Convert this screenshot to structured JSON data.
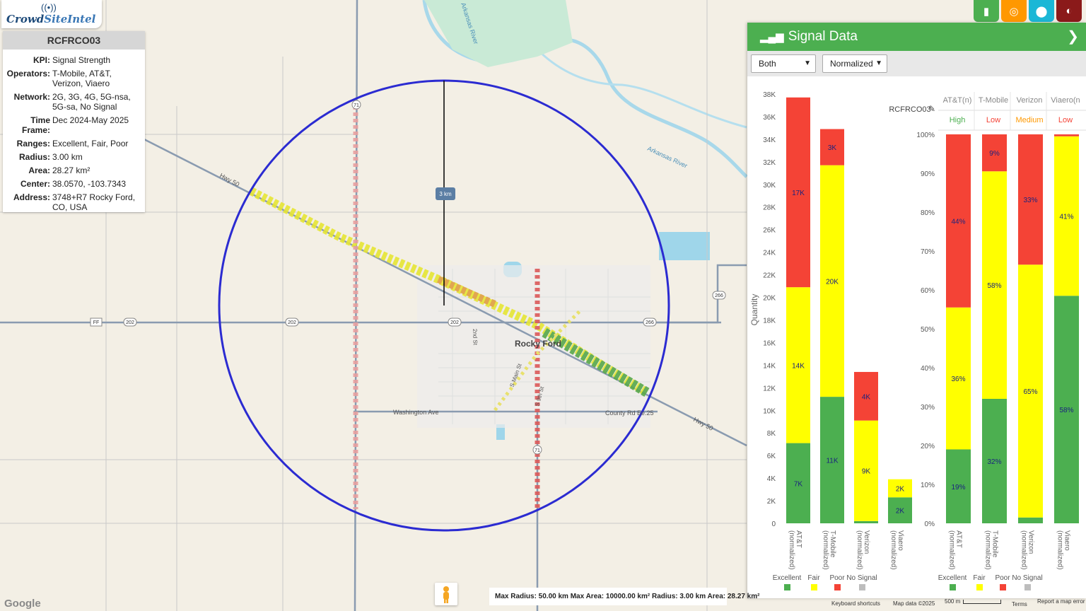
{
  "logo": {
    "text_a": "Crowd",
    "text_b": "SiteIntel"
  },
  "info": {
    "title": "RCFRCO03",
    "rows": [
      {
        "k": "KPI:",
        "v": "Signal Strength"
      },
      {
        "k": "Operators:",
        "v": "T-Mobile, AT&T, Verizon, Viaero"
      },
      {
        "k": "Network:",
        "v": "2G, 3G, 4G, 5G-nsa, 5G-sa, No Signal"
      },
      {
        "k": "Time Frame:",
        "v": "Dec 2024-May 2025"
      },
      {
        "k": "Ranges:",
        "v": "Excellent, Fair, Poor"
      },
      {
        "k": "Radius:",
        "v": "3.00 km"
      },
      {
        "k": "Area:",
        "v": "28.27 km²"
      },
      {
        "k": "Center:",
        "v": "38.0570, -103.7343"
      },
      {
        "k": "Address:",
        "v": "3748+R7 Rocky Ford, CO, USA"
      }
    ]
  },
  "topbar": {
    "buttons": [
      {
        "name": "bar-chart-icon",
        "color": "#4caf50",
        "glyph": "▮"
      },
      {
        "name": "target-icon",
        "color": "#ff9800",
        "glyph": "◎"
      },
      {
        "name": "pin-icon",
        "color": "#1bb7d6",
        "glyph": "⬤"
      },
      {
        "name": "globe-icon",
        "color": "#8b1a1a",
        "glyph": "◐"
      }
    ]
  },
  "panel": {
    "title": "Signal Data",
    "select_mode": "Both",
    "select_norm": "Normalized",
    "chart_title": "RCFRCO03",
    "rating_headers": [
      "AT&T(n)",
      "T-Mobile",
      "Verizon",
      "Viaero(n"
    ],
    "ratings": [
      "High",
      "Low",
      "Medium",
      "Low"
    ],
    "rating_colors": [
      "#4caf50",
      "#f44336",
      "#ff9800",
      "#f44336"
    ],
    "legend": [
      {
        "label": "Excellent",
        "color": "#4caf50"
      },
      {
        "label": "Fair",
        "color": "#ffff00"
      },
      {
        "label": "Poor",
        "color": "#f44336"
      },
      {
        "label": "No Signal",
        "color": "#bdbdbd"
      }
    ]
  },
  "chart_data": [
    {
      "type": "bar",
      "stacked": true,
      "title": "RCFRCO03",
      "ylabel": "Quantity",
      "ylim": [
        0,
        38000
      ],
      "yticks": [
        "0",
        "2K",
        "4K",
        "6K",
        "8K",
        "10K",
        "12K",
        "14K",
        "16K",
        "18K",
        "20K",
        "22K",
        "24K",
        "26K",
        "28K",
        "30K",
        "32K",
        "34K",
        "36K",
        "38K"
      ],
      "categories": [
        "AT&T (normalized)",
        "T-Mobile (normalized)",
        "Verizon (normalized)",
        "Viaero (normalized)"
      ],
      "series": [
        {
          "name": "Excellent",
          "color": "#4caf50",
          "values": [
            7100,
            11200,
            200,
            2300
          ],
          "labels": [
            "7K",
            "11K",
            "",
            "2K"
          ]
        },
        {
          "name": "Fair",
          "color": "#ffff00",
          "values": [
            13800,
            20500,
            8900,
            1600
          ],
          "labels": [
            "14K",
            "20K",
            "9K",
            "2K"
          ]
        },
        {
          "name": "Poor",
          "color": "#f44336",
          "values": [
            16800,
            3200,
            4300,
            0
          ],
          "labels": [
            "17K",
            "3K",
            "4K",
            ""
          ]
        }
      ]
    },
    {
      "type": "bar",
      "stacked": true,
      "ylim": [
        0,
        100
      ],
      "yticks": [
        "0%",
        "10%",
        "20%",
        "30%",
        "40%",
        "50%",
        "60%",
        "70%",
        "80%",
        "90%",
        "100%"
      ],
      "categories": [
        "AT&T (normalized)",
        "T-Mobile (normalized)",
        "Verizon (normalized)",
        "Viaero (normalized)"
      ],
      "series": [
        {
          "name": "Excellent",
          "color": "#4caf50",
          "values": [
            19,
            32,
            1.5,
            58.5
          ],
          "labels": [
            "19%",
            "32%",
            "",
            "58%"
          ]
        },
        {
          "name": "Fair",
          "color": "#ffff00",
          "values": [
            36.5,
            58.5,
            65,
            41
          ],
          "labels": [
            "36%",
            "58%",
            "65%",
            "41%"
          ]
        },
        {
          "name": "Poor",
          "color": "#f44336",
          "values": [
            44.5,
            9.5,
            33.5,
            0.5
          ],
          "labels": [
            "44%",
            "9%",
            "33%",
            ""
          ]
        }
      ]
    }
  ],
  "map": {
    "labels": {
      "town": "Rocky Ford",
      "river1": "Arkansas River",
      "river2": "Arkansas River",
      "hwy50w": "Hwy 50",
      "hwy50e": "Hwy 50",
      "washington": "Washington Ave",
      "county": "County Rd Ee.25",
      "second": "2nd St",
      "smain": "S Main St",
      "s9th": "S 9th St",
      "radius_tag": "3 km"
    },
    "shields": [
      "202",
      "202",
      "202",
      "266",
      "266",
      "FF",
      "71",
      "71"
    ]
  },
  "scale": {
    "text": "Max Radius: 50.00 km Max Area: 10000.00 km² Radius: 3.00 km Area: 28.27 km²"
  },
  "footer": {
    "google": "Google",
    "shortcuts": "Keyboard shortcuts",
    "mapdata": "Map data ©2025",
    "scale": "500 m",
    "terms": "Terms",
    "report": "Report a map error"
  }
}
